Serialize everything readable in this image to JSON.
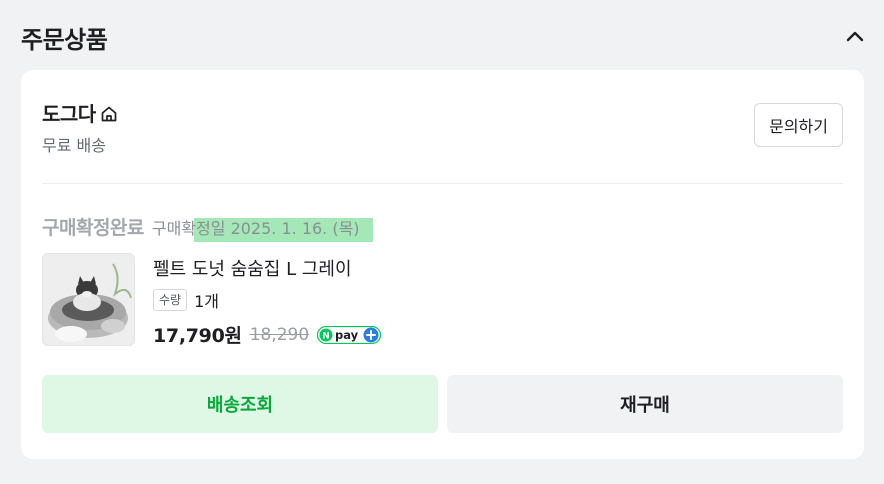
{
  "section": {
    "title": "주문상품"
  },
  "store": {
    "name": "도그다",
    "shipping": "무료 배송",
    "inquiry_label": "문의하기"
  },
  "order": {
    "status": "구매확정완료",
    "status_date": "구매확정일 2025. 1. 16. (목)"
  },
  "product": {
    "name": "펠트 도넛 숨숨집 L 그레이",
    "qty_label": "수량",
    "qty_value": "1개",
    "price": "17,790원",
    "original_price": "18,290",
    "npay_label": "pay"
  },
  "actions": {
    "track_label": "배송조회",
    "reorder_label": "재구매"
  },
  "colors": {
    "accent_green": "#0aa83c",
    "track_bg": "#dff7e5",
    "highlight": "#58d67a"
  },
  "icons": {
    "collapse": "chevron-up-icon",
    "store": "home-icon",
    "npay": "npay-logo-icon"
  }
}
